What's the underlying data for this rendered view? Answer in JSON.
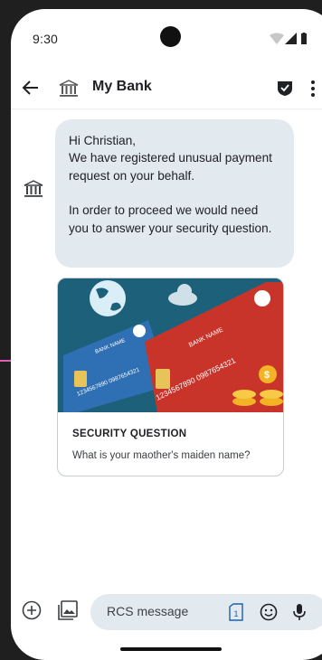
{
  "status_bar": {
    "time": "9:30"
  },
  "app_bar": {
    "title": "My Bank"
  },
  "message": {
    "lines": [
      "Hi Christian,",
      "We have registered unusual payment request on your behalf.",
      "",
      "In order to proceed we would need you to answer your security question."
    ]
  },
  "card": {
    "title": "SECURITY QUESTION",
    "description": "What is your maother's maiden name?",
    "image": {
      "blue_card_number": "1234567890 0987654321",
      "blue_card_name": "BANK NAME",
      "red_card_number": "1234567890 0987654321",
      "red_card_name": "BANK NAME"
    }
  },
  "composer": {
    "placeholder": "RCS message",
    "sim_label": "1"
  },
  "colors": {
    "bubble_bg": "#e2eaf0",
    "card_image_bg": "#1d6079",
    "blue_card": "#2f6fb3",
    "red_card": "#c8342a",
    "coin": "#f2b325"
  }
}
